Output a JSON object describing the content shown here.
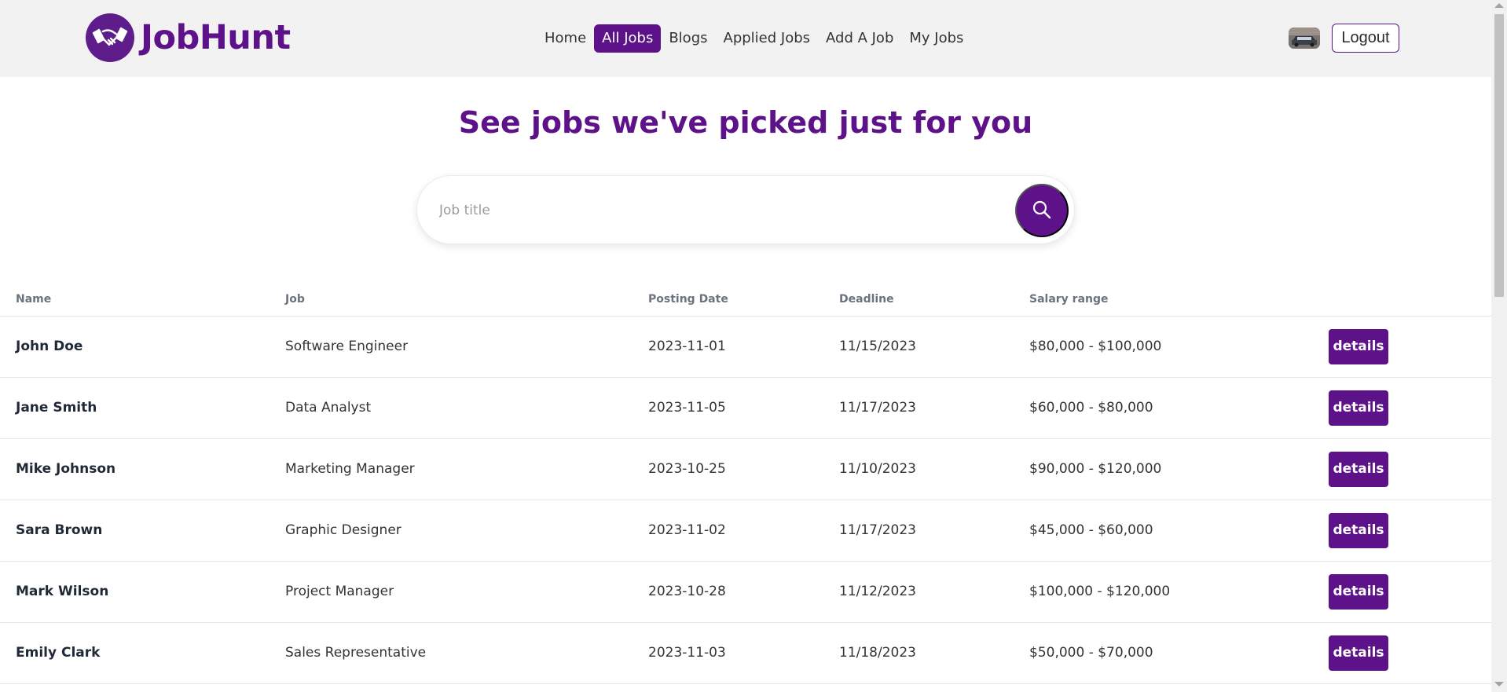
{
  "brand": {
    "name": "JobHunt",
    "logo_icon": "handshake-icon"
  },
  "nav": {
    "items": [
      {
        "label": "Home",
        "active": false
      },
      {
        "label": "All Jobs",
        "active": true
      },
      {
        "label": "Blogs",
        "active": false
      },
      {
        "label": "Applied Jobs",
        "active": false
      },
      {
        "label": "Add A Job",
        "active": false
      },
      {
        "label": "My Jobs",
        "active": false
      }
    ],
    "logout_label": "Logout"
  },
  "hero": {
    "headline": "See jobs we've picked just for you"
  },
  "search": {
    "placeholder": "Job title",
    "value": "",
    "icon": "search-icon"
  },
  "table": {
    "columns": [
      "Name",
      "Job",
      "Posting Date",
      "Deadline",
      "Salary range",
      ""
    ],
    "action_label": "details",
    "rows": [
      {
        "name": "John Doe",
        "job": "Software Engineer",
        "posting_date": "2023-11-01",
        "deadline": "11/15/2023",
        "salary": "$80,000 - $100,000"
      },
      {
        "name": "Jane Smith",
        "job": "Data Analyst",
        "posting_date": "2023-11-05",
        "deadline": "11/17/2023",
        "salary": "$60,000 - $80,000"
      },
      {
        "name": "Mike Johnson",
        "job": "Marketing Manager",
        "posting_date": "2023-10-25",
        "deadline": "11/10/2023",
        "salary": "$90,000 - $120,000"
      },
      {
        "name": "Sara Brown",
        "job": "Graphic Designer",
        "posting_date": "2023-11-02",
        "deadline": "11/17/2023",
        "salary": "$45,000 - $60,000"
      },
      {
        "name": "Mark Wilson",
        "job": "Project Manager",
        "posting_date": "2023-10-28",
        "deadline": "11/12/2023",
        "salary": "$100,000 - $120,000"
      },
      {
        "name": "Emily Clark",
        "job": "Sales Representative",
        "posting_date": "2023-11-03",
        "deadline": "11/18/2023",
        "salary": "$50,000 - $70,000"
      }
    ]
  },
  "colors": {
    "brand": "#5e1289",
    "navbar_bg": "#f2f2f3"
  }
}
